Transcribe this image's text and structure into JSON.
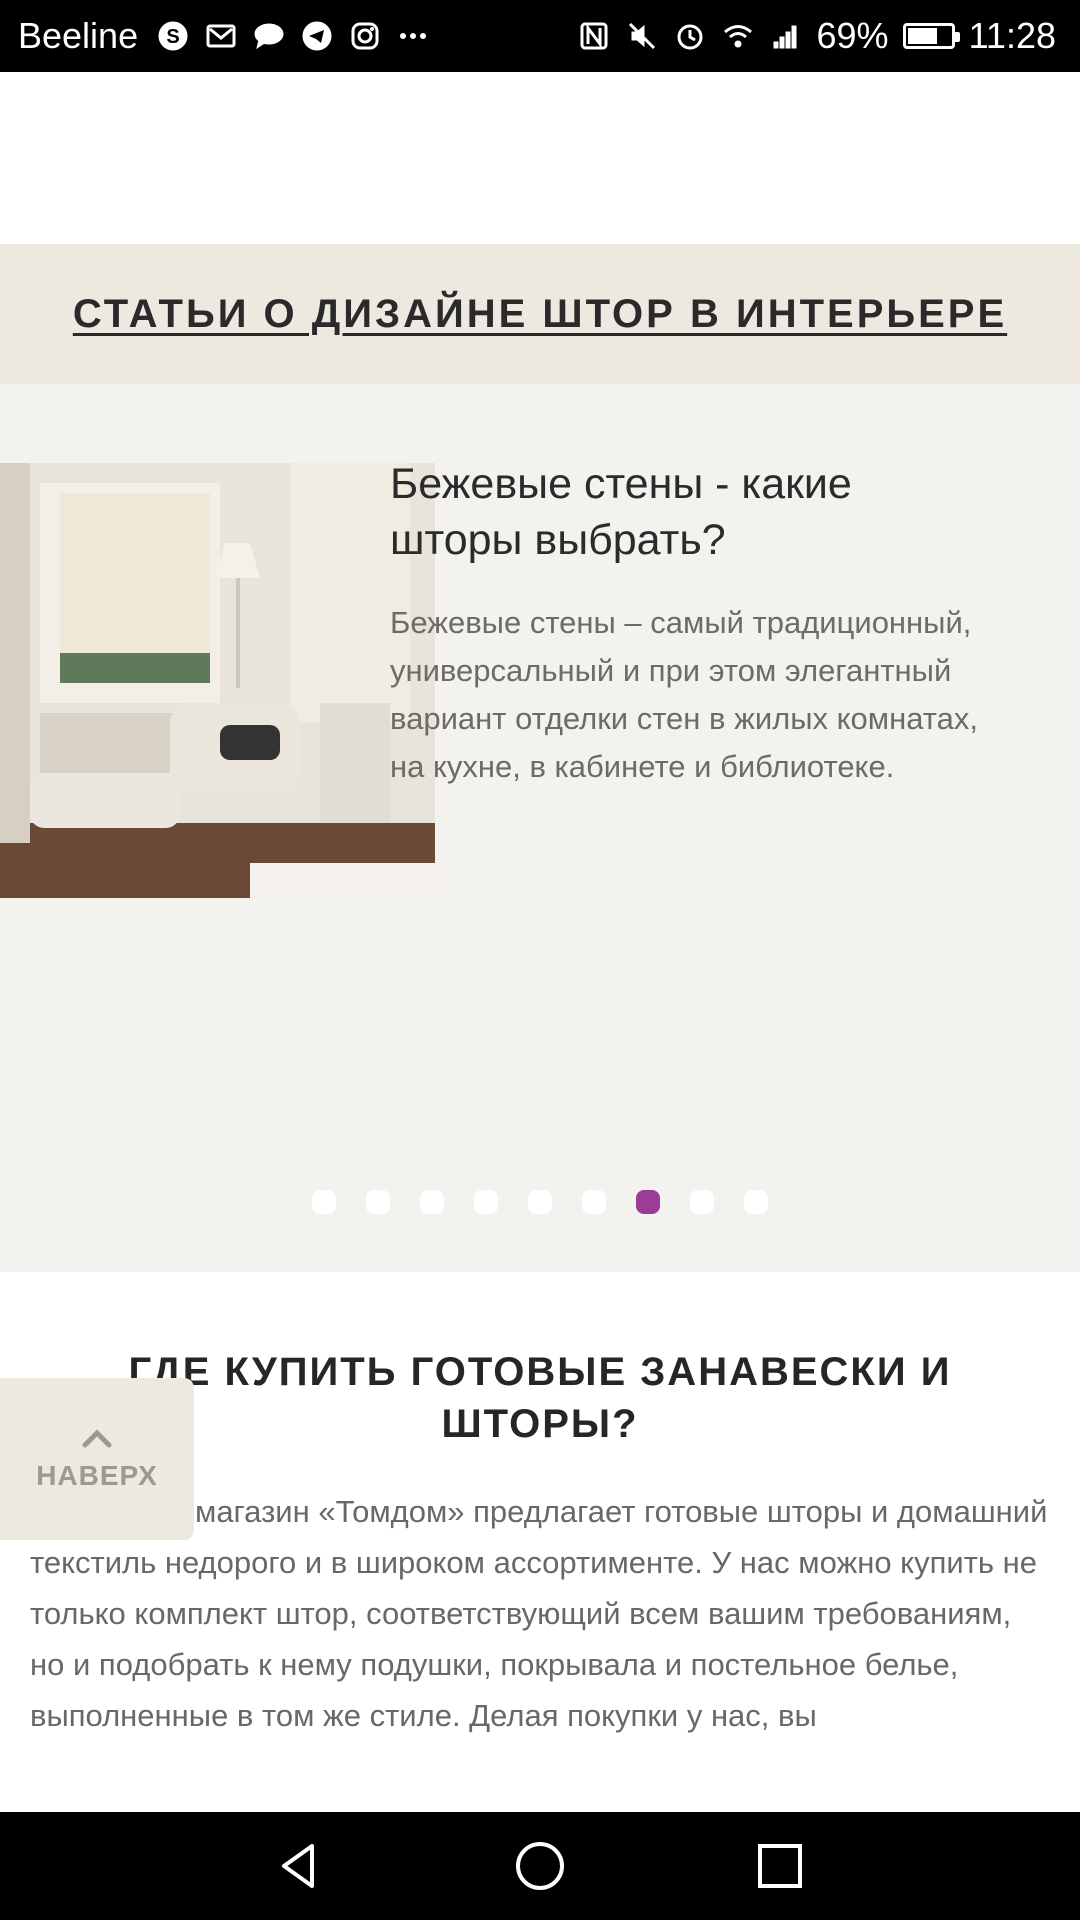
{
  "status_bar": {
    "carrier": "Beeline",
    "battery_percent": "69%",
    "battery_level": 0.69,
    "time": "11:28",
    "left_icons": [
      "skype-icon",
      "mail-icon",
      "message-icon",
      "telegram-icon",
      "instagram-icon",
      "more-icon"
    ],
    "right_icons": [
      "nfc-icon",
      "mute-icon",
      "alarm-icon",
      "wifi-icon",
      "signal-icon",
      "battery-icon"
    ]
  },
  "articles": {
    "header": "СТАТЬИ О ДИЗАЙНЕ ШТОР В ИНТЕРЬЕРЕ"
  },
  "slider": {
    "slide": {
      "title": "Бежевые стены - какие шторы выбрать?",
      "text": "Бежевые стены – самый традиционный, универсальный и при этом элегантный вариант отделки стен в жилых комнатах, на кухне, в кабинете и библиотеке."
    },
    "dots_count": 9,
    "active_index": 6,
    "active_color": "#9b3d97"
  },
  "buy": {
    "title": "ГДЕ КУПИТЬ ГОТОВЫЕ ЗАНАВЕСКИ И ШТОРЫ?",
    "text": "магазин «Томдом» предлагает готовые шторы и домашний текстиль недорого и в широком ассортименте. У нас можно купить не только комплект штор, соответствующий всем вашим требованиям, но и подобрать к нему подушки, покрывала и постельное белье, выполненные в том же стиле. Делая покупки у нас, вы"
  },
  "to_top": {
    "label": "НАВЕРХ"
  },
  "nav": {
    "buttons": [
      "back-icon",
      "home-icon",
      "recents-icon"
    ]
  }
}
